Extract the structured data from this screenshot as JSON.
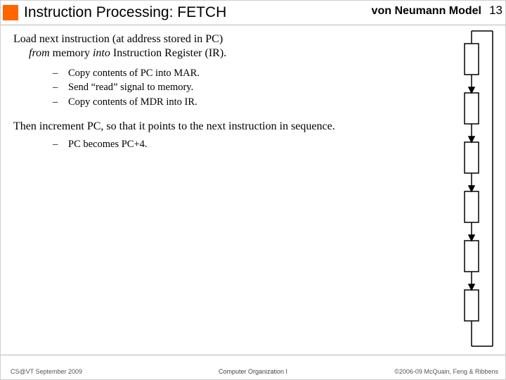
{
  "header": {
    "title": "Instruction Processing: FETCH",
    "subtitle": "von Neumann Model",
    "page": "13"
  },
  "body": {
    "para1_line1": "Load next instruction (at address stored in PC)",
    "para1_line2_before": "from",
    "para1_line2_mid": " memory ",
    "para1_line2_after": "into",
    "para1_line2_tail": " Instruction Register (IR).",
    "sub1": "Copy contents of PC into MAR.",
    "sub2": "Send “read” signal to memory.",
    "sub3": "Copy contents of MDR into IR.",
    "para2": "Then increment PC, so that it points to the next instruction in sequence.",
    "sub4": "PC becomes PC+4."
  },
  "footer": {
    "left": "CS@VT September 2009",
    "center": "Computer Organization I",
    "right": "©2006-09  McQuain, Feng & Ribbens"
  }
}
